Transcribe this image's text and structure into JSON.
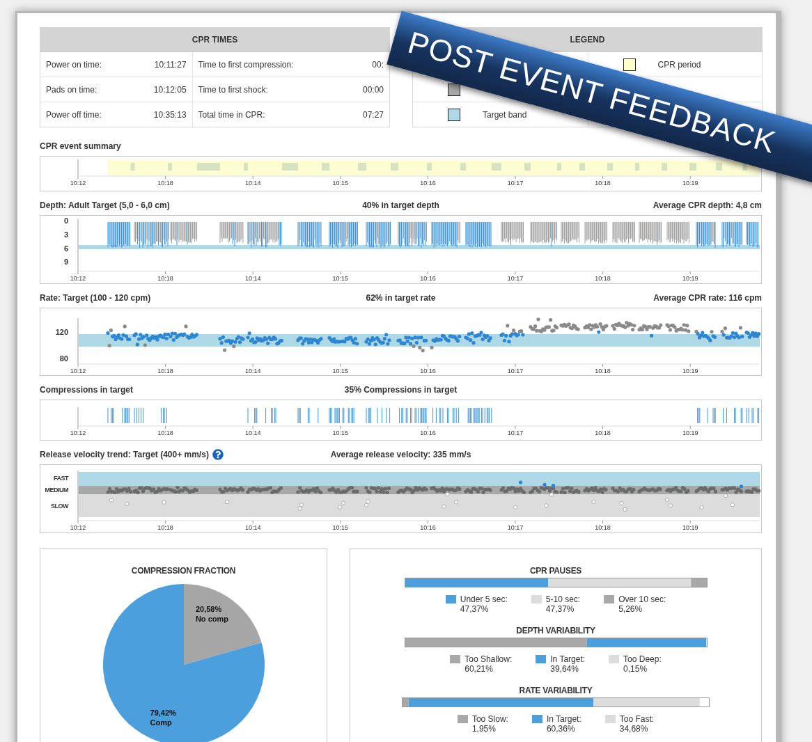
{
  "cpr_times": {
    "title": "CPR TIMES",
    "rows": [
      {
        "cells": [
          {
            "label": "Power on time:",
            "value": "10:11:27"
          },
          {
            "label": "Time to first compression:",
            "value": "00:"
          }
        ]
      },
      {
        "cells": [
          {
            "label": "Pads on time:",
            "value": "10:12:05"
          },
          {
            "label": "Time to first shock:",
            "value": "00:00"
          }
        ]
      },
      {
        "cells": [
          {
            "label": "Power off time:",
            "value": "10:35:13"
          },
          {
            "label": "Total time in CPR:",
            "value": "07:27"
          }
        ]
      }
    ]
  },
  "legend": {
    "title": "LEGEND",
    "rows": [
      {
        "right": {
          "label": "CPR period",
          "color": "#ffffcc"
        }
      },
      {
        "left": {
          "color": "#a8a8a8"
        }
      },
      {
        "left": {
          "label": "Target band",
          "color": "#add8e6"
        }
      }
    ]
  },
  "charts": [
    {
      "kind": "events",
      "title": "CPR event summary",
      "x_labels": [
        "10:12",
        "10:18",
        "10:14",
        "10:15",
        "10:16",
        "10:17",
        "10:18",
        "10:19"
      ]
    },
    {
      "kind": "depth",
      "title": "Depth: Adult Target (5,0 - 6,0 cm)",
      "center": "40% in target depth",
      "right": "Average CPR depth: 4,8 cm",
      "y_labels": [
        "0",
        "3",
        "6",
        "9"
      ],
      "x_labels": [
        "10:12",
        "10:18",
        "10:14",
        "10:15",
        "10:16",
        "10:17",
        "10:18",
        "10:19"
      ]
    },
    {
      "kind": "rate",
      "title": "Rate: Target (100 - 120 cpm)",
      "center": "62% in target rate",
      "right": "Average CPR rate: 116 cpm",
      "y_labels": [
        "120",
        "80"
      ],
      "x_labels": [
        "10:12",
        "10:18",
        "10:14",
        "10:15",
        "10:16",
        "10:17",
        "10:18",
        "10:19"
      ]
    },
    {
      "kind": "compressions",
      "title": "Compressions in target",
      "center": "35% Compressions in target",
      "x_labels": [
        "10:12",
        "10:18",
        "10:14",
        "10:15",
        "10:16",
        "10:17",
        "10:18",
        "10:19"
      ]
    },
    {
      "kind": "velocity",
      "title": "Release velocity trend: Target (400+ mm/s)",
      "help": true,
      "center": "Average release velocity: 335 mm/s",
      "y_labels": [
        "FAST",
        "MEDIUM",
        "SLOW"
      ],
      "x_labels": [
        "10:12",
        "10:18",
        "10:14",
        "10:15",
        "10:16",
        "10:17",
        "10:18",
        "10:19"
      ]
    }
  ],
  "compression_fraction": {
    "chart_data": {
      "type": "pie",
      "title": "COMPRESSION FRACTION",
      "categories": [
        "No comp",
        "Comp"
      ],
      "values": [
        20.58,
        79.42
      ],
      "value_labels": [
        "20,58%",
        "79,42%"
      ]
    }
  },
  "variability": [
    {
      "title": "CPR PAUSES",
      "items": [
        {
          "label": "Under 5 sec:",
          "value": "47,37%",
          "color": "#4a9fdc"
        },
        {
          "label": "5-10 sec:",
          "value": "47,37%",
          "color": "#dcdcdc"
        },
        {
          "label": "Over 10 sec:",
          "value": "5,26%",
          "color": "#a8a8a8"
        }
      ]
    },
    {
      "title": "DEPTH VARIABILITY",
      "items": [
        {
          "label": "Too Shallow:",
          "value": "60,21%",
          "color": "#a8a8a8"
        },
        {
          "label": "In Target:",
          "value": "39,64%",
          "color": "#4a9fdc"
        },
        {
          "label": "Too Deep:",
          "value": "0,15%",
          "color": "#dcdcdc"
        }
      ]
    },
    {
      "title": "RATE VARIABILITY",
      "items": [
        {
          "label": "Too Slow:",
          "value": "1,95%",
          "color": "#a8a8a8"
        },
        {
          "label": "In Target:",
          "value": "60,36%",
          "color": "#4a9fdc"
        },
        {
          "label": "Too Fast:",
          "value": "34,68%",
          "color": "#dcdcdc"
        }
      ]
    }
  ],
  "banner": {
    "text": "POST EVENT FEEDBACK"
  }
}
